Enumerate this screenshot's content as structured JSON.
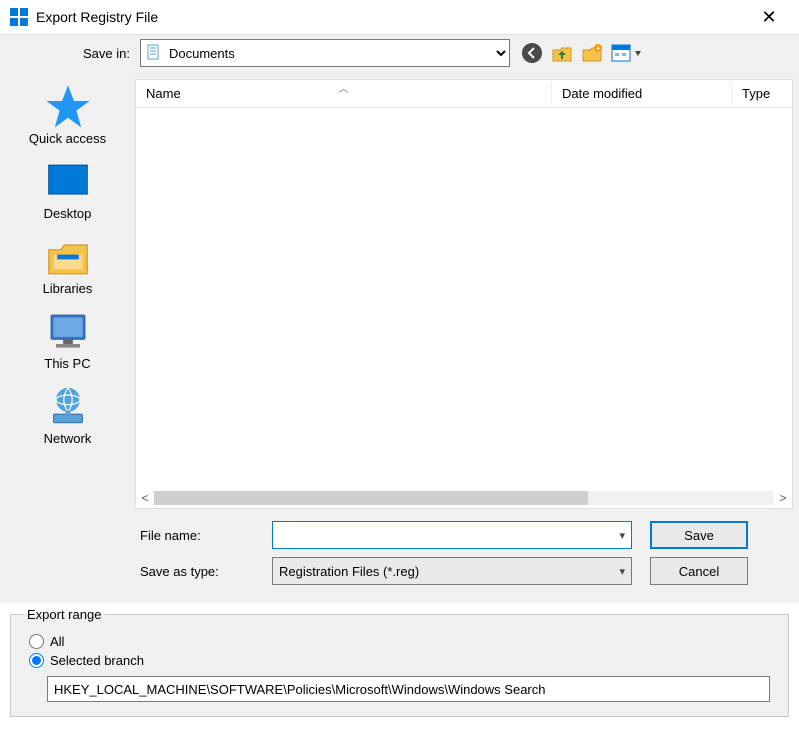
{
  "title": "Export Registry File",
  "toolbar": {
    "save_in_label": "Save in:",
    "save_in_value": "Documents",
    "nav": {
      "back": "back-icon",
      "up": "up-icon",
      "newfolder": "new-folder-icon",
      "views": "views-icon"
    }
  },
  "places": [
    {
      "label": "Quick access",
      "icon": "star-icon"
    },
    {
      "label": "Desktop",
      "icon": "desktop-icon"
    },
    {
      "label": "Libraries",
      "icon": "libraries-icon"
    },
    {
      "label": "This PC",
      "icon": "thispc-icon"
    },
    {
      "label": "Network",
      "icon": "network-icon"
    }
  ],
  "columns": {
    "name": "Name",
    "date": "Date modified",
    "type": "Type"
  },
  "form": {
    "file_name_label": "File name:",
    "file_name_value": "",
    "save_as_type_label": "Save as type:",
    "save_as_type_value": "Registration Files (*.reg)",
    "save_button": "Save",
    "cancel_button": "Cancel"
  },
  "export_range": {
    "legend": "Export range",
    "option_all": "All",
    "option_selected": "Selected branch",
    "selected": "selected",
    "branch_value": "HKEY_LOCAL_MACHINE\\SOFTWARE\\Policies\\Microsoft\\Windows\\Windows Search"
  }
}
